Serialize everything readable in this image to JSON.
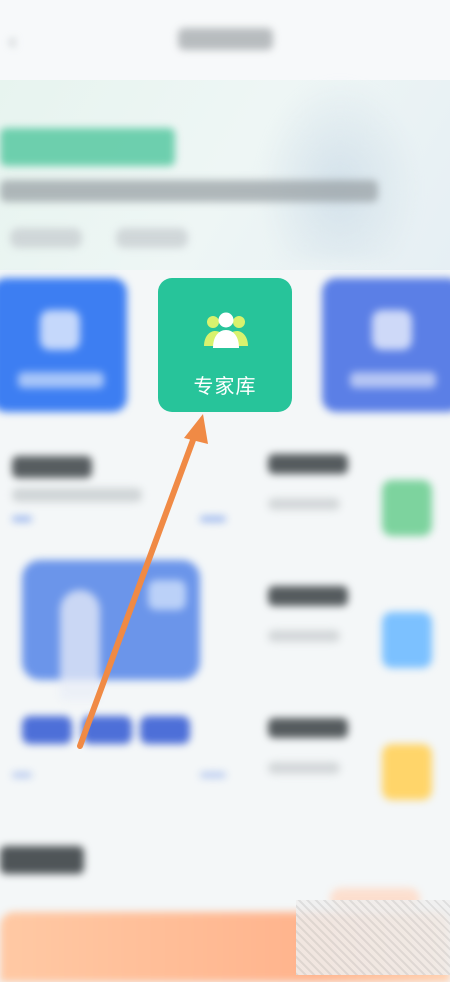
{
  "nav": {
    "back_icon": "back-icon"
  },
  "cards": [
    {
      "icon": "chart-icon",
      "color": "#3d7ef2"
    },
    {
      "label": "专家库",
      "icon": "people-icon",
      "color": "#27c49a"
    },
    {
      "icon": "document-icon",
      "color": "#5b7fe6"
    }
  ],
  "annotation": {
    "type": "arrow",
    "color": "#f08a45",
    "points_to": "专家库"
  },
  "colors": {
    "accent_green": "#27c49a",
    "accent_blue": "#3d7ef2",
    "banner_orange": "#ffb38c"
  }
}
